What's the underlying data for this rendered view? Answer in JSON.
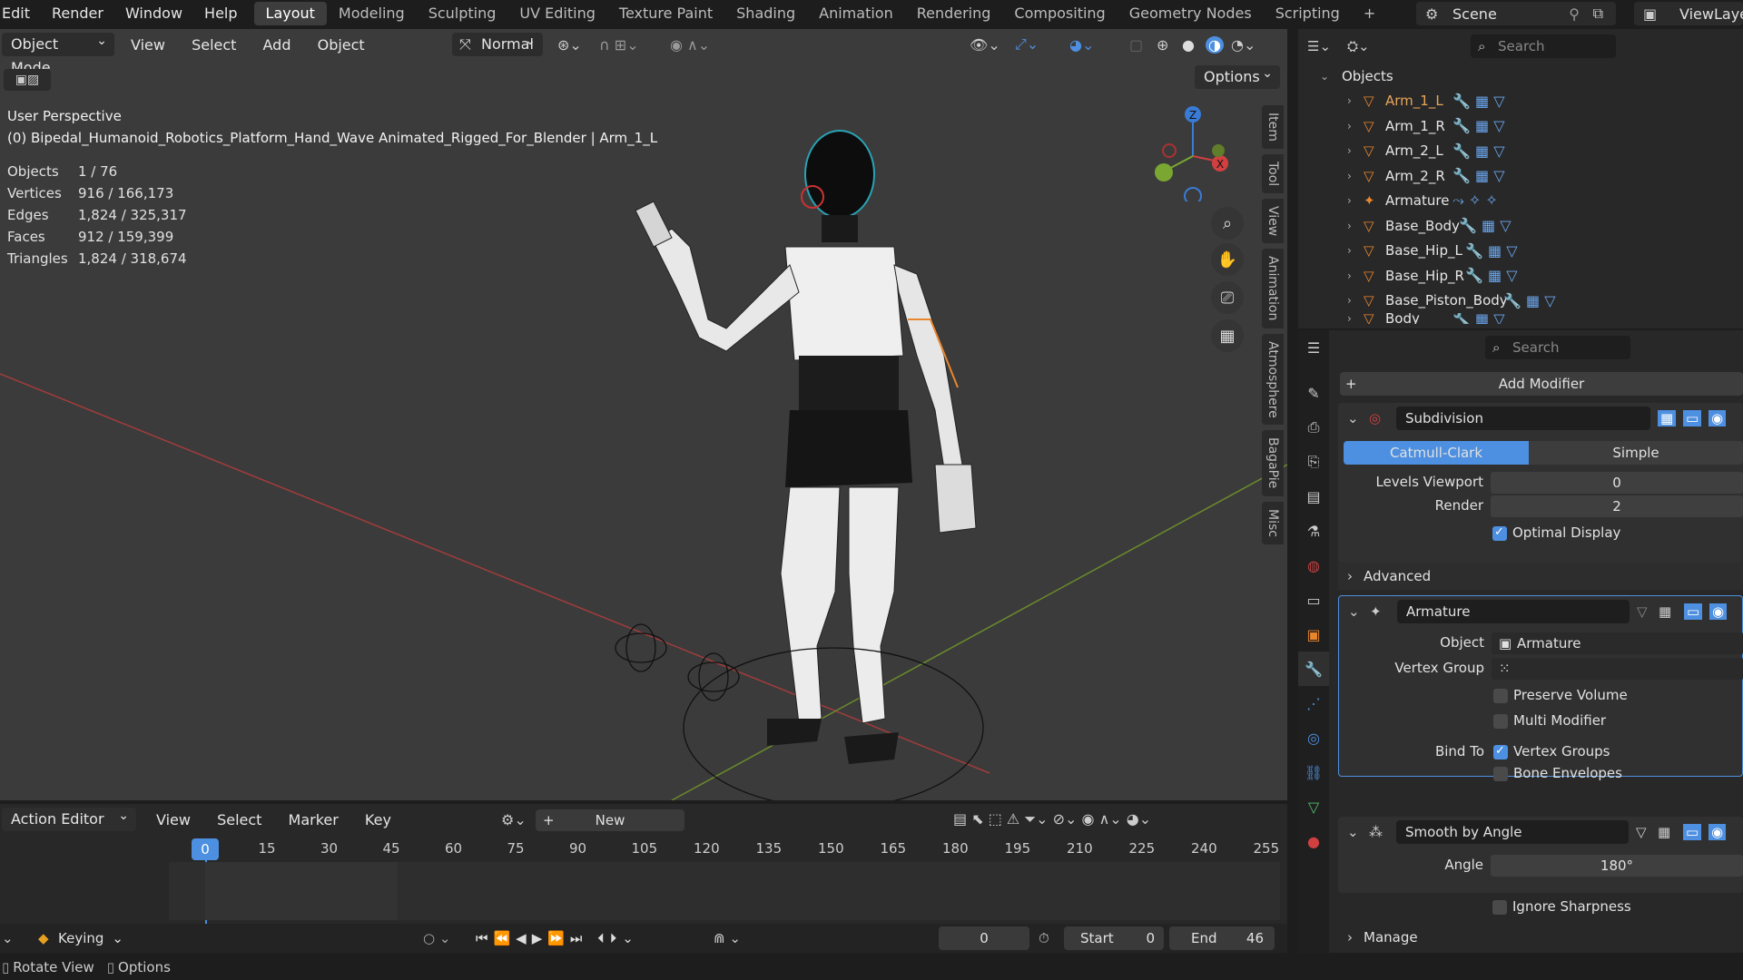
{
  "topbar": {
    "menus": [
      "Edit",
      "Render",
      "Window",
      "Help"
    ],
    "workspaces": [
      "Layout",
      "Modeling",
      "Sculpting",
      "UV Editing",
      "Texture Paint",
      "Shading",
      "Animation",
      "Rendering",
      "Compositing",
      "Geometry Nodes",
      "Scripting"
    ],
    "active_workspace": "Layout",
    "add": "+",
    "scene": "Scene",
    "view_layer": "ViewLaye"
  },
  "viewport": {
    "mode": "Object Mode",
    "menus": [
      "View",
      "Select",
      "Add",
      "Object"
    ],
    "orientation": "Normal",
    "options": "Options",
    "perspective": "User Perspective",
    "object_info": "(0) Bipedal_Humanoid_Robotics_Platform_Hand_Wave Animated_Rigged_For_Blender | Arm_1_L",
    "stats": [
      {
        "k": "Objects",
        "v": "1 / 76"
      },
      {
        "k": "Vertices",
        "v": "916 / 166,173"
      },
      {
        "k": "Edges",
        "v": "1,824 / 325,317"
      },
      {
        "k": "Faces",
        "v": "912 / 159,399"
      },
      {
        "k": "Triangles",
        "v": "1,824 / 318,674"
      }
    ],
    "side_tabs": [
      "Item",
      "Tool",
      "View",
      "Animation",
      "Atmosphere",
      "BagaPie",
      "Misc"
    ],
    "gizmo": {
      "z": "Z",
      "x": "X"
    }
  },
  "outliner": {
    "search_placeholder": "Search",
    "collection": "Objects",
    "rows": [
      {
        "name": "Arm_1_L",
        "selected": true
      },
      {
        "name": "Arm_1_R"
      },
      {
        "name": "Arm_2_L"
      },
      {
        "name": "Arm_2_R"
      },
      {
        "name": "Armature"
      },
      {
        "name": "Base_Body"
      },
      {
        "name": "Base_Hip_L"
      },
      {
        "name": "Base_Hip_R"
      },
      {
        "name": "Base_Piston_Body"
      },
      {
        "name": "Body"
      }
    ]
  },
  "properties": {
    "search_placeholder": "Search",
    "add_modifier": "Add Modifier",
    "subdivision": {
      "name": "Subdivision",
      "tab_a": "Catmull-Clark",
      "tab_b": "Simple",
      "levels_label": "Levels Viewport",
      "levels_value": "0",
      "render_label": "Render",
      "render_value": "2",
      "optimal": "Optimal Display",
      "advanced": "Advanced"
    },
    "armature": {
      "name": "Armature",
      "object_label": "Object",
      "object_value": "Armature",
      "vgroup_label": "Vertex Group",
      "preserve": "Preserve Volume",
      "multi": "Multi Modifier",
      "bind_label": "Bind To",
      "vertex_groups": "Vertex Groups",
      "bone_env": "Bone Envelopes"
    },
    "smooth": {
      "name": "Smooth by Angle",
      "angle_label": "Angle",
      "angle_value": "180°",
      "ignore": "Ignore Sharpness",
      "manage": "Manage"
    }
  },
  "timeline": {
    "editor": "Action Editor",
    "menus": [
      "View",
      "Select",
      "Marker",
      "Key"
    ],
    "new_label": "New",
    "frames": [
      "0",
      "15",
      "30",
      "45",
      "60",
      "75",
      "90",
      "105",
      "120",
      "135",
      "150",
      "165",
      "180",
      "195",
      "210",
      "225",
      "240",
      "255"
    ],
    "current_frame": "0",
    "keying": "Keying",
    "start_label": "Start",
    "start_value": "0",
    "end_label": "End",
    "end_value": "46"
  },
  "statusbar": {
    "rotate": "Rotate View",
    "options": "Options"
  },
  "colors": {
    "accent": "#4d8fe0",
    "orange": "#e8862e",
    "bg": "#3b3b3b"
  }
}
